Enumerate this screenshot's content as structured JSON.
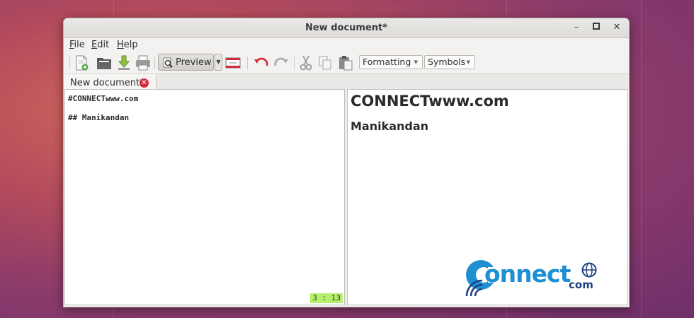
{
  "window": {
    "title": "New document*",
    "controls": {
      "minimize": "–",
      "close": "✕"
    }
  },
  "menu": {
    "file": {
      "mnemonic": "F",
      "rest": "ile"
    },
    "edit": {
      "mnemonic": "E",
      "rest": "dit"
    },
    "help": {
      "mnemonic": "H",
      "rest": "elp"
    }
  },
  "toolbar": {
    "preview_label": "Preview",
    "formatting_label": "Formatting",
    "symbols_label": "Symbols",
    "icons": [
      "new-document-icon",
      "open-folder-icon",
      "save-icon",
      "print-icon",
      "preview-icon",
      "fullscreen-icon",
      "undo-icon",
      "redo-icon",
      "cut-icon",
      "copy-icon",
      "paste-icon"
    ]
  },
  "tab": {
    "label": "New document*",
    "close_glyph": "✕"
  },
  "editor": {
    "lines": [
      "#CONNECTwww.com",
      "## Manikandan"
    ],
    "cursor_status": "3 : 13"
  },
  "preview": {
    "h1": "CONNECTwww.com",
    "h2": "Manikandan"
  },
  "watermark": {
    "main": "onnect",
    "sub": "com"
  },
  "colors": {
    "accent_red": "#d6283a",
    "status_green": "#b5f06c",
    "logo_blue": "#1e8fd0",
    "logo_dark": "#1e3f80"
  }
}
